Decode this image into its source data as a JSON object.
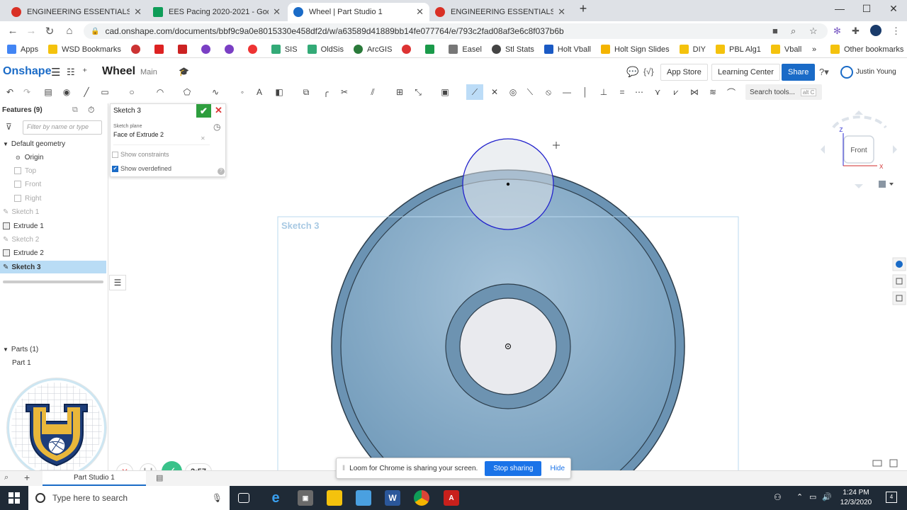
{
  "browser": {
    "tabs": [
      {
        "label": "ENGINEERING ESSENTIALS-PP5-",
        "favicon_color": "#d93025"
      },
      {
        "label": "EES Pacing 2020-2021 - Google",
        "favicon_color": "#0f9d58"
      },
      {
        "label": "Wheel | Part Studio 1",
        "favicon_color": "#1a6bc7",
        "active": true
      },
      {
        "label": "ENGINEERING ESSENTIALS-PP5-",
        "favicon_color": "#d93025"
      }
    ],
    "url": "cad.onshape.com/documents/bbf9c9a0e8015330e458df2d/w/a63589d41889bb14fe077764/e/793c2fad08af3e6c8f037b6b",
    "bookmarks": [
      "Apps",
      "WSD Bookmarks",
      "SIS",
      "OldSis",
      "ArcGIS",
      "Easel",
      "Stl Stats",
      "Holt Vball",
      "Holt Sign Slides",
      "DIY",
      "PBL Alg1",
      "Vball"
    ],
    "bookmarks_more": "»",
    "other_bookmarks": "Other bookmarks"
  },
  "onshape": {
    "logo": "Onshape",
    "doc_name": "Wheel",
    "workspace": "Main",
    "app_store": "App Store",
    "learning_center": "Learning Center",
    "share": "Share",
    "user": "Justin Young",
    "search_tools": "Search tools...",
    "search_kb": "alt C"
  },
  "features": {
    "title": "Features (9)",
    "filter_placeholder": "Filter by name or type",
    "default_geometry": "Default geometry",
    "items": [
      "Origin",
      "Top",
      "Front",
      "Right",
      "Sketch 1",
      "Extrude 1",
      "Sketch 2",
      "Extrude 2",
      "Sketch 3"
    ],
    "parts_title": "Parts (1)",
    "parts": [
      "Part 1"
    ]
  },
  "sketch_dialog": {
    "title": "Sketch 3",
    "plane_label": "Sketch plane",
    "plane_value": "Face of Extrude 2",
    "show_constraints": "Show constraints",
    "show_overdefined": "Show overdefined"
  },
  "viewport": {
    "sketch_label": "Sketch 3",
    "view_cube_label": "Front",
    "axis_z": "Z",
    "axis_x": "X"
  },
  "loom": {
    "message": "Loom for Chrome is sharing your screen.",
    "stop": "Stop sharing",
    "hide": "Hide"
  },
  "recorder": {
    "time": "2:57"
  },
  "bottom": {
    "tab": "Part Studio 1"
  },
  "taskbar": {
    "search_placeholder": "Type here to search",
    "time": "1:24 PM",
    "date": "12/3/2020"
  },
  "colors": {
    "wheel": "#7ea6c4",
    "accent": "#1a6bc7",
    "sketch_circle": "#2222cc"
  }
}
